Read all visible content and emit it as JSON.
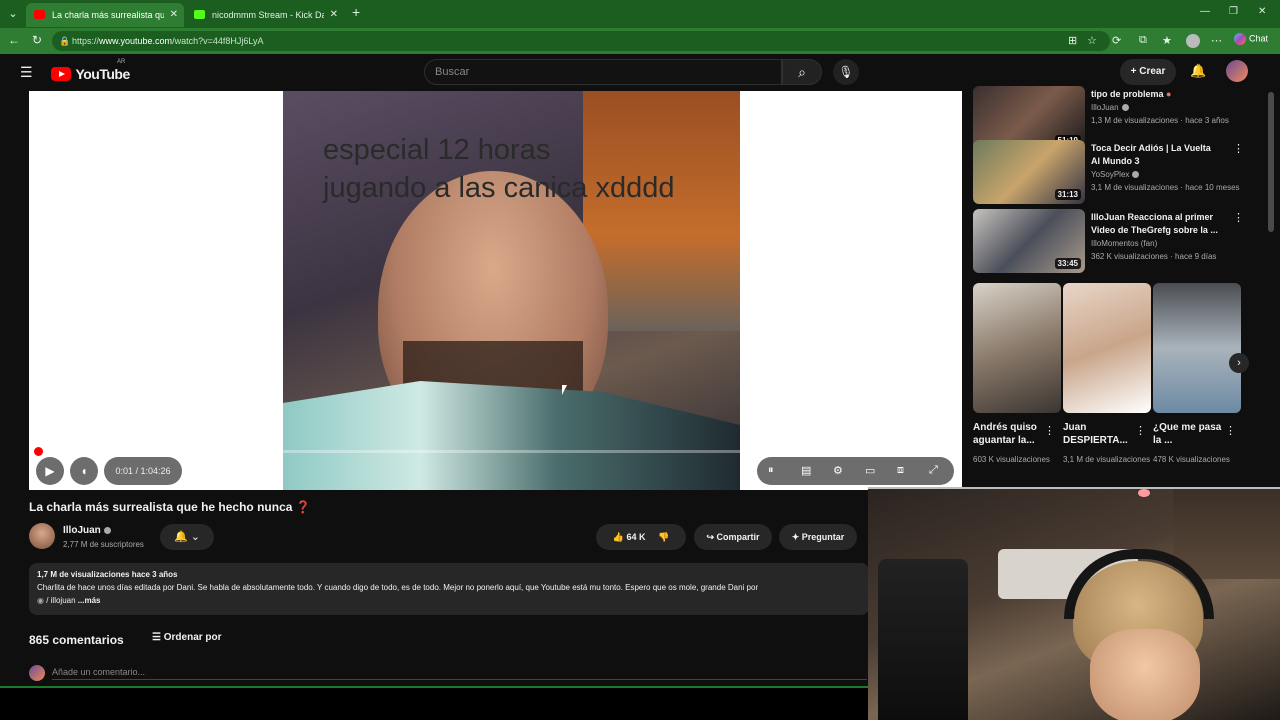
{
  "browser": {
    "tabs": [
      {
        "label": "La charla más surrealista que he hecho nunca",
        "favicon_color": "#ff0000"
      },
      {
        "label": "nicodmmm Stream - Kick Dashboard",
        "favicon_color": "#53fc18"
      }
    ],
    "url_prefix": "https://",
    "url_host": "www.youtube.com",
    "url_path": "/watch?v=44f8HJj6LyA",
    "chat_label": "Chat",
    "accent": "#2e7d32"
  },
  "yt": {
    "logo_text": "YouTube",
    "country": "AR",
    "search_placeholder": "Buscar",
    "create_label": "Crear"
  },
  "player": {
    "caption_line1": "especial 12 horas",
    "caption_line2": "jugando a las canica xdddd",
    "time": "0:01 / 1:04:26",
    "progress": 0.003
  },
  "video": {
    "title": "La charla más surrealista que he hecho nunca",
    "title_emoji": "❓",
    "channel": "IlloJuan",
    "subscribers": "2,77 M de suscriptores",
    "likes": "64 K",
    "share_label": "Compartir",
    "ask_label": "Preguntar",
    "views_date": "1,7 M de visualizaciones  hace 3 años",
    "description": "Charlita de hace unos días editada por Dani. Se habla de absolutamente todo. Y cuando digo de todo, es de todo. Mejor no ponerlo aquí, que Youtube está mu tonto. Espero que os mole, grande Dani por",
    "link": "/ illojuan",
    "more": "...más"
  },
  "comments": {
    "count": "865 comentarios",
    "sort_label": "Ordenar por",
    "placeholder": "Añade un comentario..."
  },
  "sidebar": {
    "items": [
      {
        "title": "tipo de problema",
        "channel": "IlloJuan",
        "meta": "1,3 M de visualizaciones · hace 3 años",
        "duration": "51:19"
      },
      {
        "title": "Toca Decir Adiós | La Vuelta Al Mundo 3",
        "channel": "YoSoyPlex",
        "meta": "3,1 M de visualizaciones · hace 10 meses",
        "duration": "31:13"
      },
      {
        "title": "IlloJuan Reacciona al primer Video de TheGrefg sobre la ...",
        "channel": "IlloMomentos (fan)",
        "meta": "362 K visualizaciones · hace 9 días",
        "duration": "33:45"
      }
    ],
    "shorts": [
      {
        "title": "Andrés quiso aguantar la...",
        "views": "603 K visualizaciones"
      },
      {
        "title": "Juan DESPIERTA...",
        "views": "3,1 M de visualizaciones"
      },
      {
        "title": "¿Que me pasa la ...",
        "views": "478 K visualizaciones"
      }
    ]
  }
}
